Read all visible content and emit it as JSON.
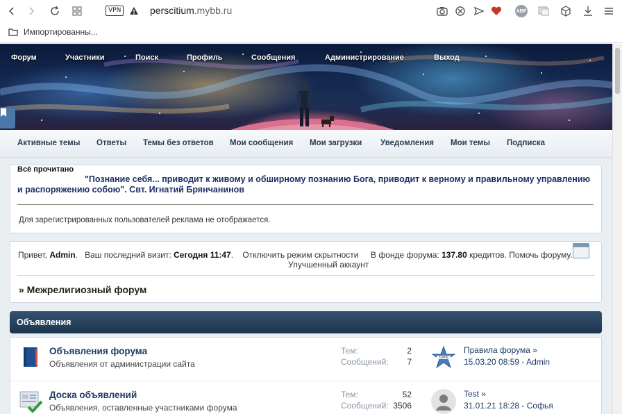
{
  "browser": {
    "vpn_label": "VPN",
    "url_domain": "perscitium",
    "url_rest": ".mybb.ru",
    "bookmark_label": "Импортированны...",
    "abp_label": "ABP"
  },
  "topnav": [
    "Форум",
    "Участники",
    "Поиск",
    "Профиль",
    "Сообщения",
    "Администрирование",
    "Выход"
  ],
  "subnav": [
    "Активные темы",
    "Ответы",
    "Темы без ответов",
    "Мои сообщения",
    "Мои загрузки",
    "Уведомления",
    "Мои темы",
    "Подписка"
  ],
  "announcement": {
    "mark_all_read": "Всё прочитано",
    "quote": "\"Познание себя... приводит к живому и обширному познанию Бога, приводит к верному и правильному управлению и распоряжению собою\". Свт. Игнатий Брянчанинов",
    "ads_note": "Для зарегистрированных пользователей реклама не отображается."
  },
  "welcome": {
    "greeting": "Привет,",
    "username": "Admin",
    "last_visit_label": "Ваш последний визит:",
    "last_visit_value": "Сегодня 11:47",
    "hidden_mode_link": "Отключить режим скрытности",
    "fund_label": "В фонде форума:",
    "fund_value": "137.80",
    "fund_unit": "кредитов.",
    "help_link": "Помочь форуму.",
    "extended_account": "Улучшенный аккаунт",
    "forum_name": "» Межрелигиозный форум"
  },
  "category": {
    "title": "Объявления",
    "forums": [
      {
        "title": "Объявления форума",
        "description": "Объявления от администрации сайта",
        "topics_label": "Тем:",
        "topics": "2",
        "posts_label": "Сообщений:",
        "posts": "7",
        "last_post_title": "Правила форума »",
        "last_post_meta": "15.03.20 08:59 - Admin",
        "avatar_text": "ADMIN"
      },
      {
        "title": "Доска объявлений",
        "description": "Объявления, оставленные участниками форума",
        "topics_label": "Тем:",
        "topics": "52",
        "posts_label": "Сообщений:",
        "posts": "3506",
        "last_post_title": "Test »",
        "last_post_meta": "31.01.21 18:28 - Софья",
        "avatar_text": ""
      }
    ]
  },
  "colors": {
    "accent": "#1d3b66",
    "category_header": "#1c354f",
    "subnav_text": "#2b3a4d",
    "heart": "#c0392b"
  }
}
